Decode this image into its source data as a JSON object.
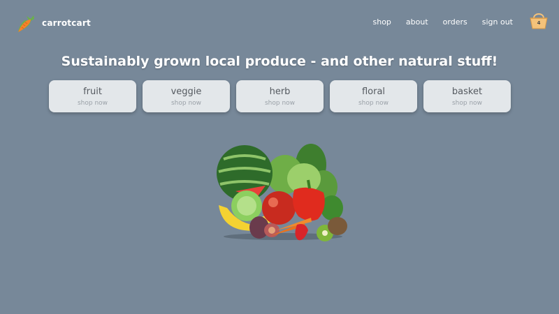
{
  "brand": {
    "name": "carrotcart",
    "logo_icon": "carrot-icon"
  },
  "nav": {
    "items": [
      {
        "label": "shop"
      },
      {
        "label": "about"
      },
      {
        "label": "orders"
      },
      {
        "label": "sign out"
      }
    ]
  },
  "cart": {
    "icon": "basket-icon",
    "count": "4"
  },
  "headline": "Sustainably grown local produce - and other natural stuff!",
  "categories": [
    {
      "title": "fruit",
      "sub": "shop now"
    },
    {
      "title": "veggie",
      "sub": "shop now"
    },
    {
      "title": "herb",
      "sub": "shop now"
    },
    {
      "title": "floral",
      "sub": "shop now"
    },
    {
      "title": "basket",
      "sub": "shop now"
    }
  ],
  "hero": {
    "icon": "produce-illustration"
  },
  "colors": {
    "background": "#778899",
    "card": "#e3e7ea",
    "carrot": "#f5822a",
    "basket": "#f4c27a"
  }
}
